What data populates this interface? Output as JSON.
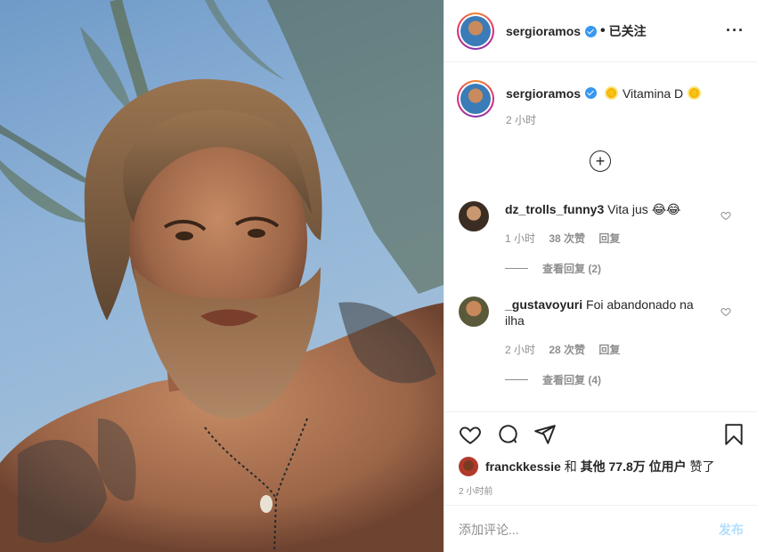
{
  "header": {
    "username": "sergioramos",
    "separator": "•",
    "follow_label": "已关注",
    "more_label": "···"
  },
  "caption": {
    "username": "sergioramos",
    "text": "Vitamina D",
    "time": "2 小时"
  },
  "expand_label": "+",
  "comments": [
    {
      "username": "dz_trolls_funny3",
      "text": "Vita jus 😂😂",
      "time": "1 小时",
      "likes": "38 次赞",
      "reply": "回复",
      "view_replies": "查看回复 (2)"
    },
    {
      "username": "_gustavoyuri",
      "text": "Foi abandonado na ilha",
      "time": "2 小时",
      "likes": "28 次赞",
      "reply": "回复",
      "view_replies": "查看回复 (4)"
    }
  ],
  "likes": {
    "user": "franckkessie",
    "connector": "和",
    "others": "其他 77.8万 位用户",
    "suffix": "赞了"
  },
  "post_time": "2 小时前",
  "add_comment": {
    "placeholder": "添加评论...",
    "post_label": "发布"
  },
  "colors": {
    "verified": "#3897f0",
    "muted": "#8e8e8e",
    "post_button": "#b2dffc",
    "text": "#262626"
  }
}
